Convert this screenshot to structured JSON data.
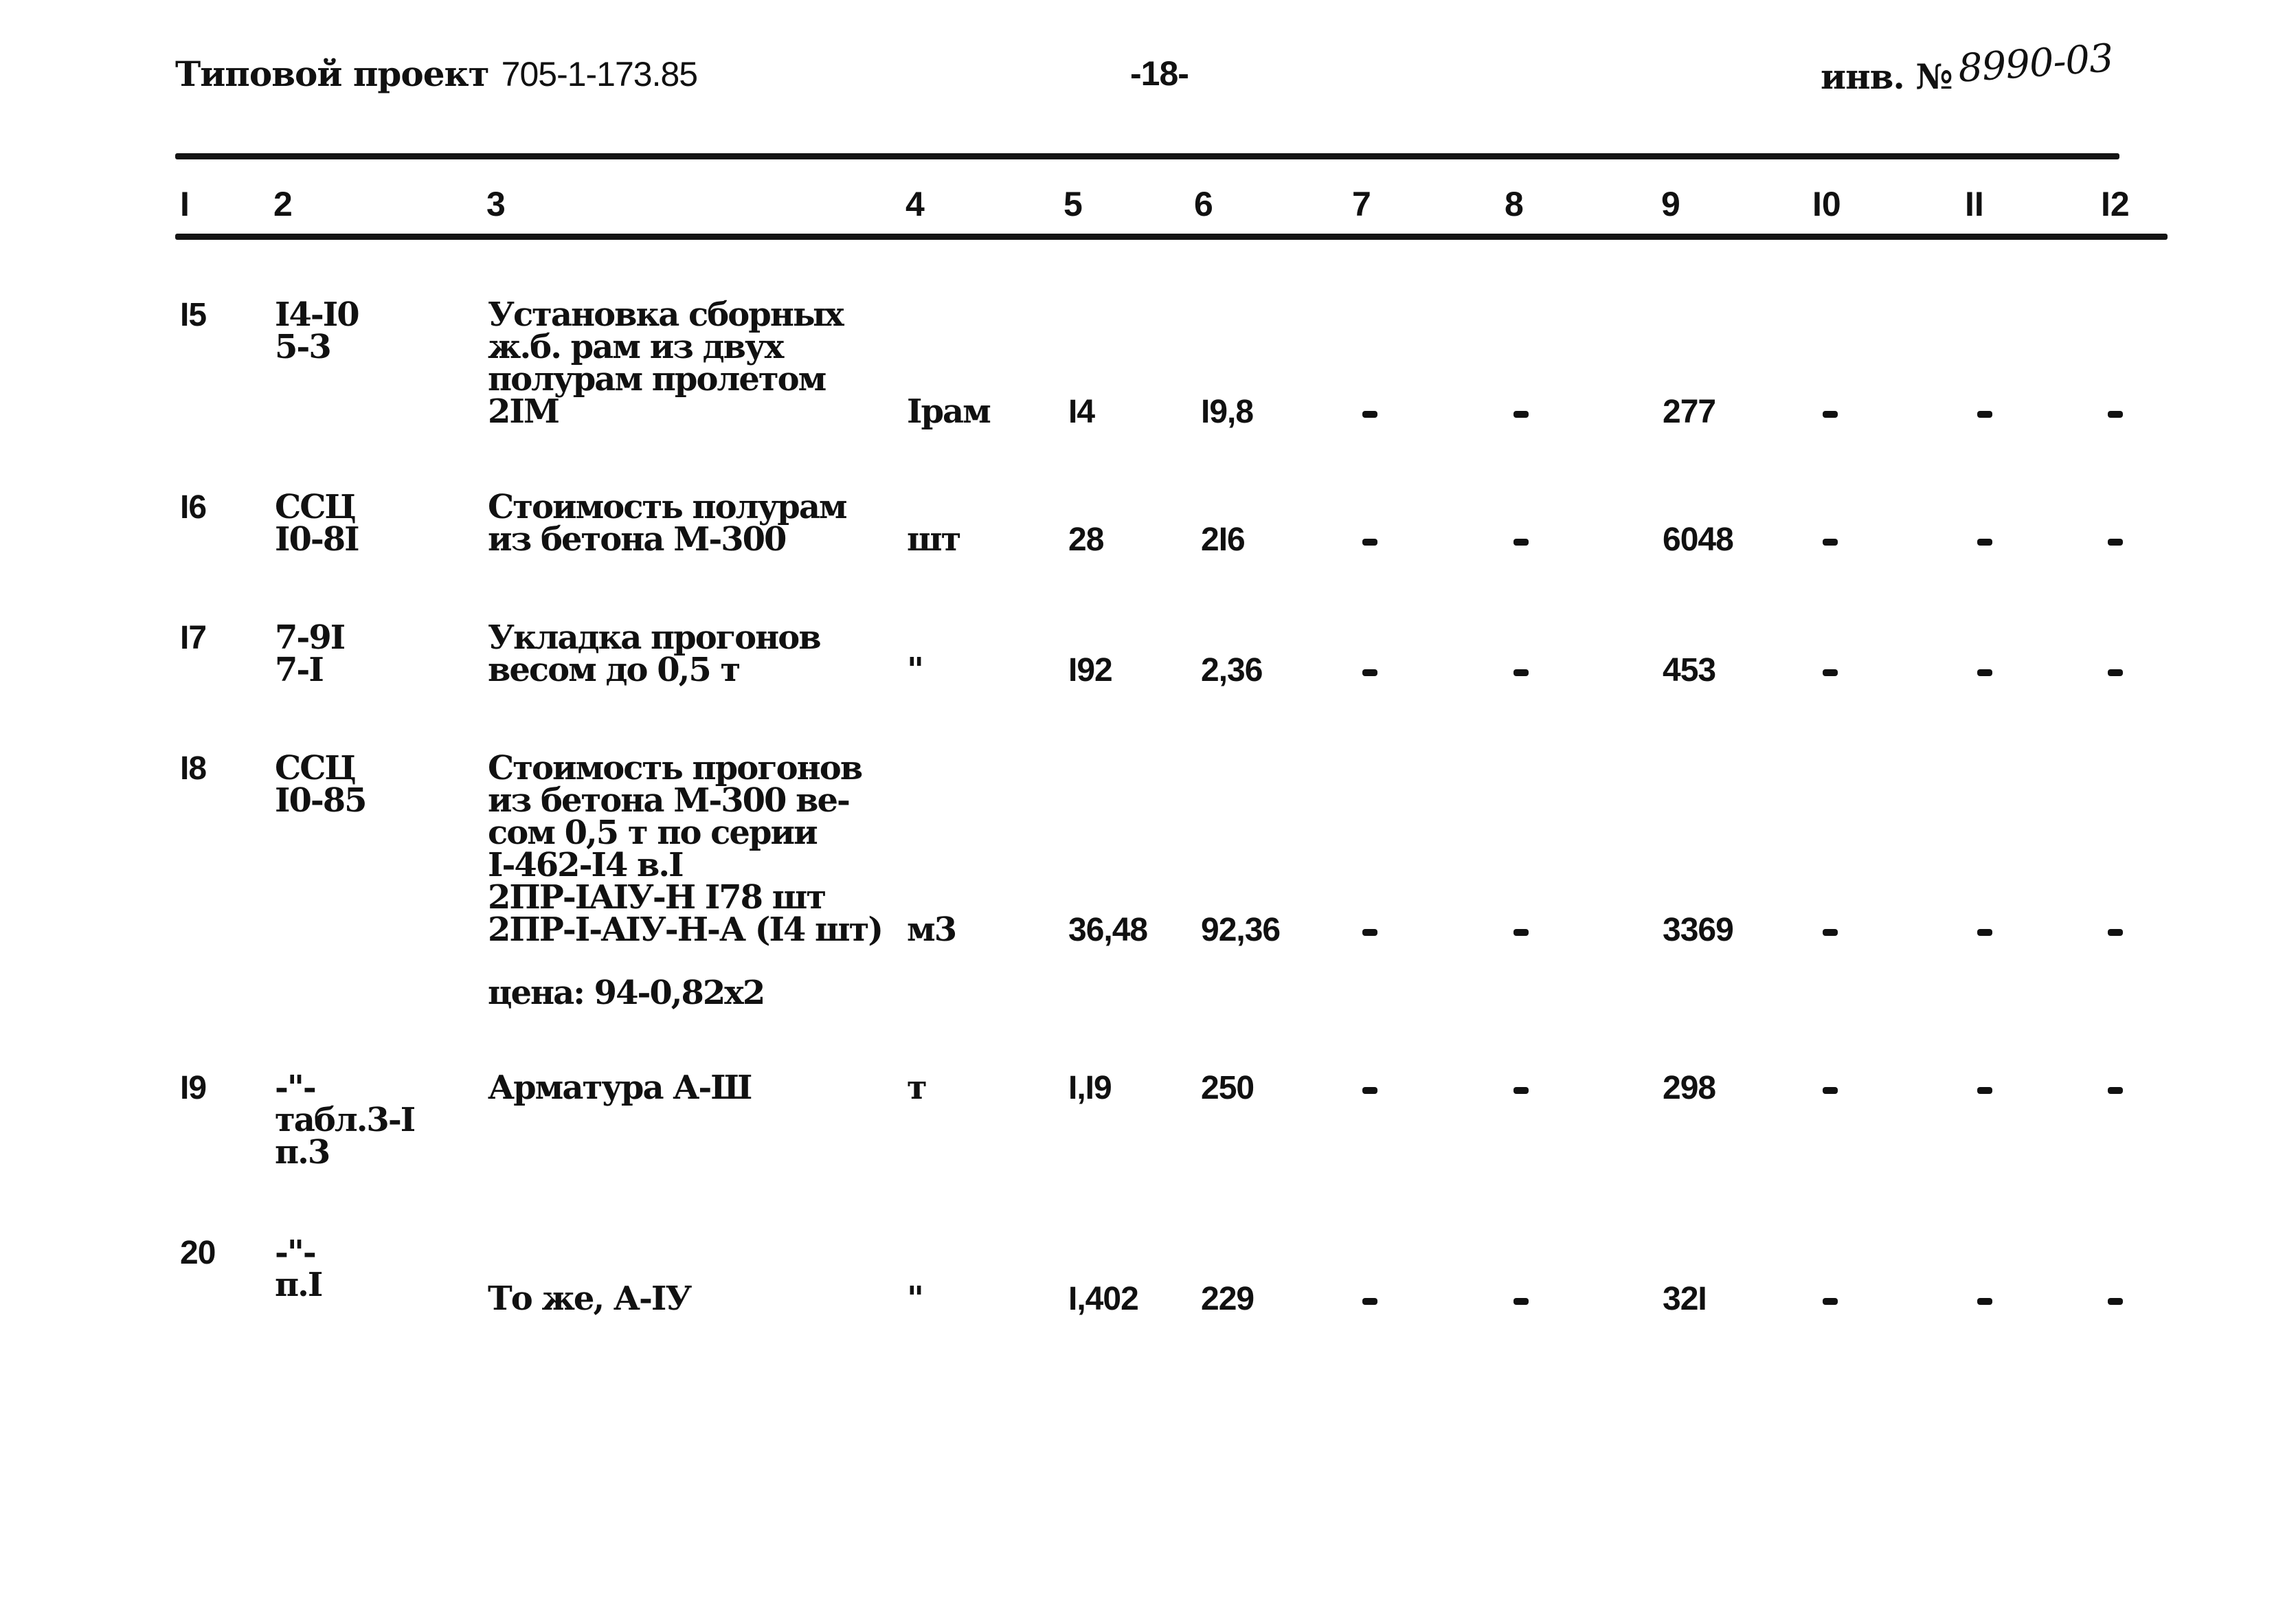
{
  "header": {
    "project_label": "Типовой проект",
    "project_code": "705-1-173.85",
    "page": "-18-",
    "inventory_label": "инв. №",
    "inventory_number": "8990-03"
  },
  "table": {
    "columns": [
      "I",
      "2",
      "3",
      "4",
      "5",
      "6",
      "7",
      "8",
      "9",
      "I0",
      "II",
      "I2"
    ],
    "rows": [
      {
        "num": "I5",
        "ref": [
          "I4-I0",
          "5-3"
        ],
        "desc": [
          "Установка сборных",
          "ж.б. рам из двух",
          "полурам пролетом",
          "2IM"
        ],
        "unit": "Iрам",
        "qty": "I4",
        "price": "I9,8",
        "c7": "-",
        "c8": "-",
        "total": "277",
        "c10": "-",
        "c11": "-",
        "c12": "-"
      },
      {
        "num": "I6",
        "ref": [
          "ССЦ",
          "I0-8I"
        ],
        "desc": [
          "Стоимость полурам",
          "из бетона М-300"
        ],
        "unit": "шт",
        "qty": "28",
        "price": "2I6",
        "c7": "-",
        "c8": "-",
        "total": "6048",
        "c10": "-",
        "c11": "-",
        "c12": "-"
      },
      {
        "num": "I7",
        "ref": [
          "7-9I",
          "7-I"
        ],
        "desc": [
          "Укладка прогонов",
          "весом до 0,5 т"
        ],
        "unit": "\"",
        "qty": "I92",
        "price": "2,36",
        "c7": "-",
        "c8": "-",
        "total": "453",
        "c10": "-",
        "c11": "-",
        "c12": "-"
      },
      {
        "num": "I8",
        "ref": [
          "ССЦ",
          "I0-85"
        ],
        "desc": [
          "Стоимость прогонов",
          "из бетона М-300 ве-",
          "сом 0,5 т по серии",
          "I-462-I4 в.I",
          "2ПР-IAIУ-Н I78 шт",
          "2ПР-I-AIУ-Н-А (I4 шт)"
        ],
        "note": "цена: 94-0,82x2",
        "unit": "м3",
        "qty": "36,48",
        "price": "92,36",
        "c7": "-",
        "c8": "-",
        "total": "3369",
        "c10": "-",
        "c11": "-",
        "c12": "-"
      },
      {
        "num": "I9",
        "ref": [
          "-\"-",
          "табл.3-I",
          "п.3"
        ],
        "desc": [
          "Арматура А-Ш"
        ],
        "unit": "т",
        "qty": "I,I9",
        "price": "250",
        "c7": "-",
        "c8": "-",
        "total": "298",
        "c10": "-",
        "c11": "-",
        "c12": "-"
      },
      {
        "num": "20",
        "ref": [
          "-\"-",
          "п.I"
        ],
        "desc": [
          "То же, А-IУ"
        ],
        "unit": "\"",
        "qty": "I,402",
        "price": "229",
        "c7": "-",
        "c8": "-",
        "total": "32I",
        "c10": "-",
        "c11": "-",
        "c12": "-"
      }
    ]
  }
}
